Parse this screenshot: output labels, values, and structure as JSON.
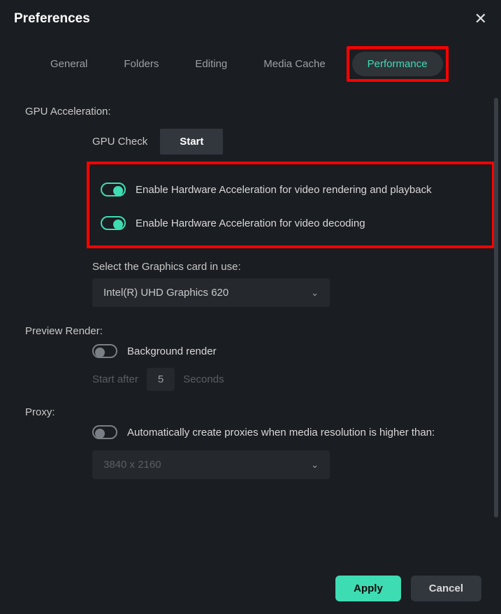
{
  "header": {
    "title": "Preferences"
  },
  "tabs": {
    "general": "General",
    "folders": "Folders",
    "editing": "Editing",
    "media_cache": "Media Cache",
    "performance": "Performance"
  },
  "gpu": {
    "section": "GPU Acceleration:",
    "check_label": "GPU Check",
    "start_label": "Start",
    "hw_render_label": "Enable Hardware Acceleration for video rendering and playback",
    "hw_decode_label": "Enable Hardware Acceleration for video decoding",
    "select_card_label": "Select the Graphics card in use:",
    "selected_card": "Intel(R) UHD Graphics 620"
  },
  "preview": {
    "section": "Preview Render:",
    "bg_render_label": "Background render",
    "start_after": "Start after",
    "start_after_value": "5",
    "seconds": "Seconds"
  },
  "proxy": {
    "section": "Proxy:",
    "auto_label": "Automatically create proxies when media resolution is higher than:",
    "resolution": "3840 x 2160"
  },
  "footer": {
    "apply": "Apply",
    "cancel": "Cancel"
  }
}
